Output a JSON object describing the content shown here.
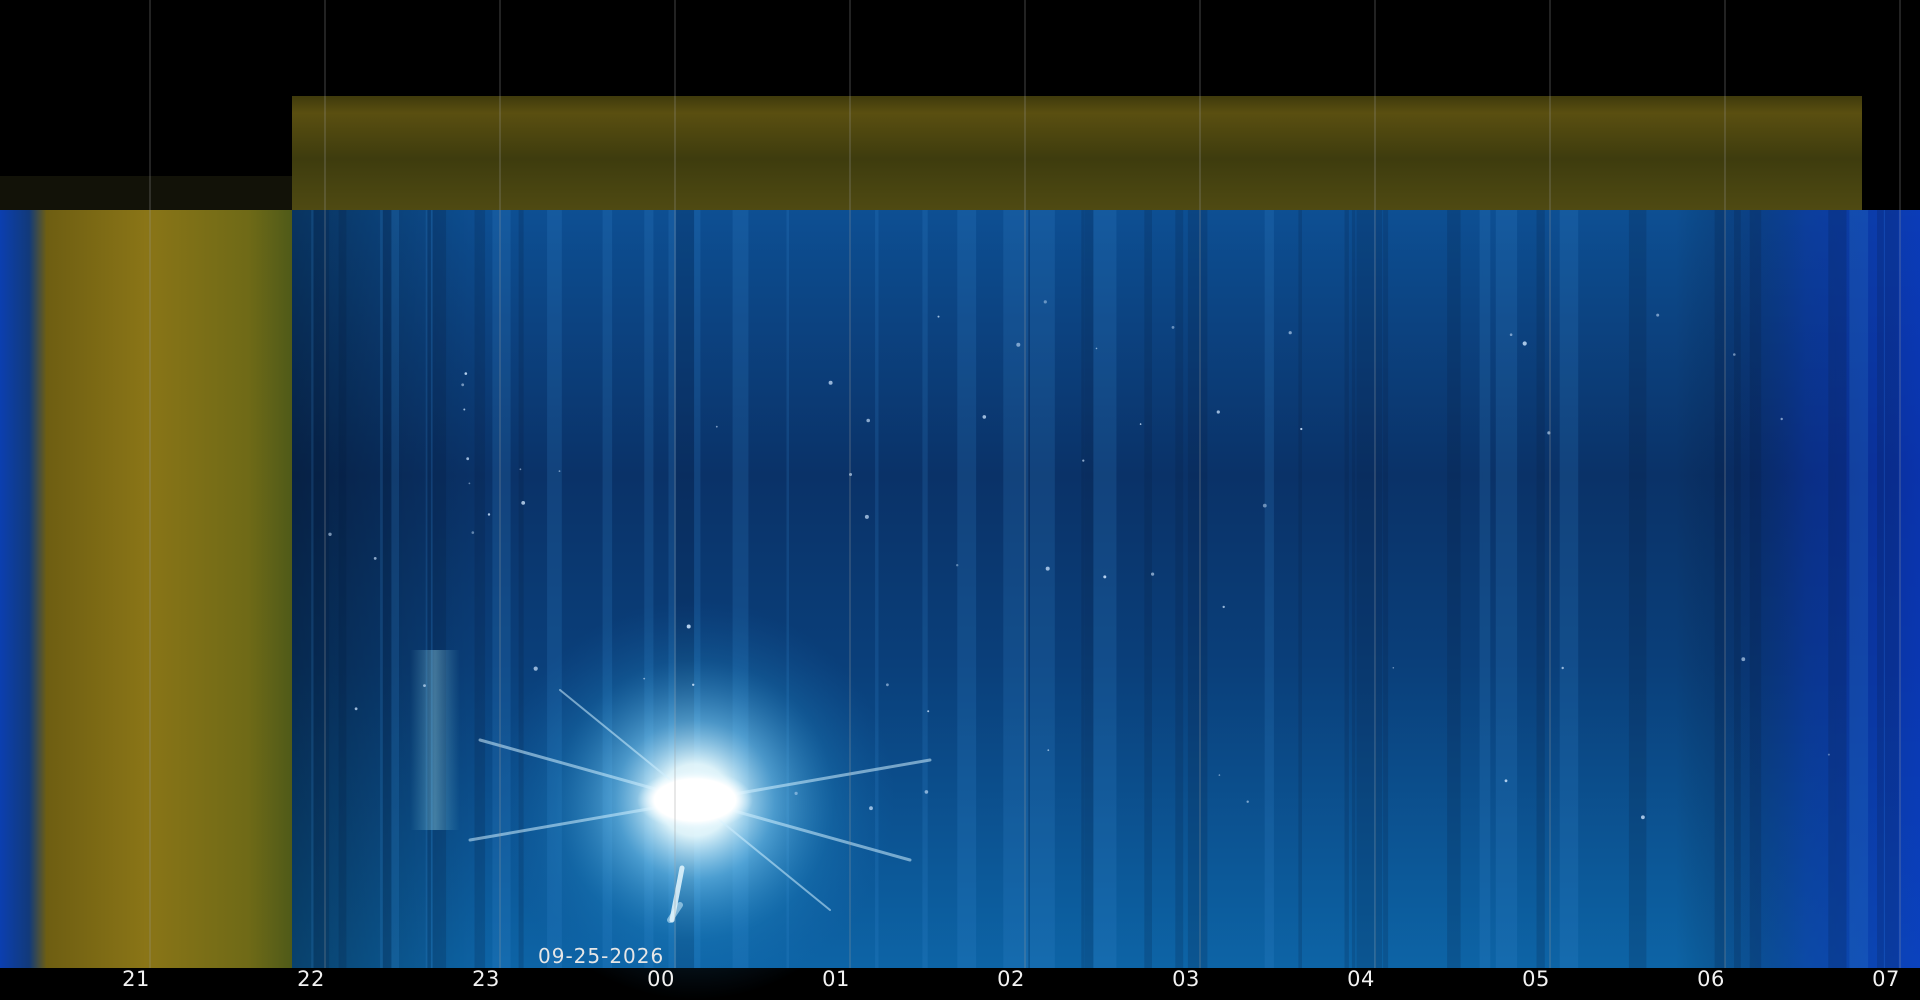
{
  "keogram": {
    "date": "09-25-2026",
    "hour_ticks": [
      "21",
      "22",
      "23",
      "00",
      "01",
      "02",
      "03",
      "04",
      "05",
      "06",
      "07"
    ],
    "colors": {
      "background": "#000000",
      "sky_blue": "#0a3d7a",
      "twilight_olive": "#7a6a14",
      "sun_glare": "#ffffff",
      "grid_line": "#9a9a9a",
      "label_text": "#f2f2f2"
    },
    "features": {
      "sun_icon": "sun-glare-icon"
    }
  }
}
